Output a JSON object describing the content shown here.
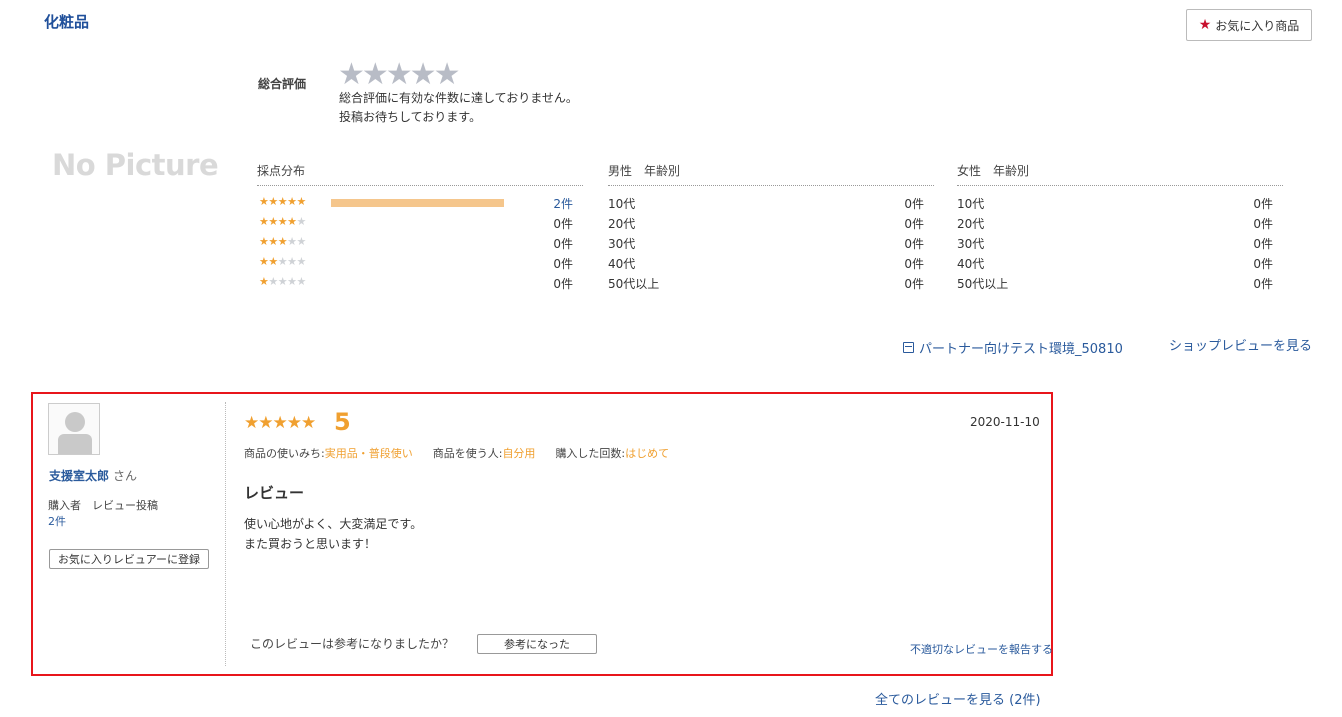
{
  "category_title": "化粧品",
  "favorite_button": {
    "label": "お気に入り商品",
    "icon": "star-icon",
    "icon_color": "#c8102e"
  },
  "no_picture_text": "No Picture",
  "overall": {
    "label": "総合評価",
    "stars_filled": 0,
    "stars_total": 5,
    "message_line1": "総合評価に有効な件数に達しておりません。",
    "message_line2": "投稿お待ちしております。"
  },
  "score_distribution": {
    "header": "採点分布",
    "rows": [
      {
        "stars": 5,
        "count": "2件",
        "share": 1.0
      },
      {
        "stars": 4,
        "count": "0件",
        "share": 0
      },
      {
        "stars": 3,
        "count": "0件",
        "share": 0
      },
      {
        "stars": 2,
        "count": "0件",
        "share": 0
      },
      {
        "stars": 1,
        "count": "0件",
        "share": 0
      }
    ]
  },
  "male_by_age": {
    "header": "男性　年齢別",
    "rows": [
      {
        "label": "10代",
        "count": "0件"
      },
      {
        "label": "20代",
        "count": "0件"
      },
      {
        "label": "30代",
        "count": "0件"
      },
      {
        "label": "40代",
        "count": "0件"
      },
      {
        "label": "50代以上",
        "count": "0件"
      }
    ]
  },
  "female_by_age": {
    "header": "女性　年齢別",
    "rows": [
      {
        "label": "10代",
        "count": "0件"
      },
      {
        "label": "20代",
        "count": "0件"
      },
      {
        "label": "30代",
        "count": "0件"
      },
      {
        "label": "40代",
        "count": "0件"
      },
      {
        "label": "50代以上",
        "count": "0件"
      }
    ]
  },
  "shop": {
    "name": "パートナー向けテスト環境_50810",
    "icon": "shop-icon",
    "review_link": "ショップレビューを見る"
  },
  "review": {
    "reviewer_name": "支援室太郎",
    "honorific": "さん",
    "stats_label": "購入者　レビュー投稿",
    "stats_value": "2件",
    "fav_reviewer_button": "お気に入りレビュアーに登録",
    "stars": "★★★★★",
    "score": "5",
    "date": "2020-11-10",
    "attributes": [
      {
        "key": "商品の使いみち:",
        "value": "実用品・普段使い"
      },
      {
        "key": "商品を使う人:",
        "value": "自分用"
      },
      {
        "key": "購入した回数:",
        "value": "はじめて"
      }
    ],
    "title": "レビュー",
    "body_line1": "使い心地がよく、大変満足です。",
    "body_line2": "また買おうと思います！",
    "helpful_question": "このレビューは参考になりましたか？",
    "helpful_button": "参考になった",
    "report_link": "不適切なレビューを報告する",
    "highlight_color": "#e8151b"
  },
  "all_reviews_link": "全てのレビューを見る (2件)",
  "colors": {
    "star_on": "#f0a030",
    "star_off": "#cfd2d6",
    "link": "#2a5a9c",
    "bar": "#f5c68c"
  }
}
